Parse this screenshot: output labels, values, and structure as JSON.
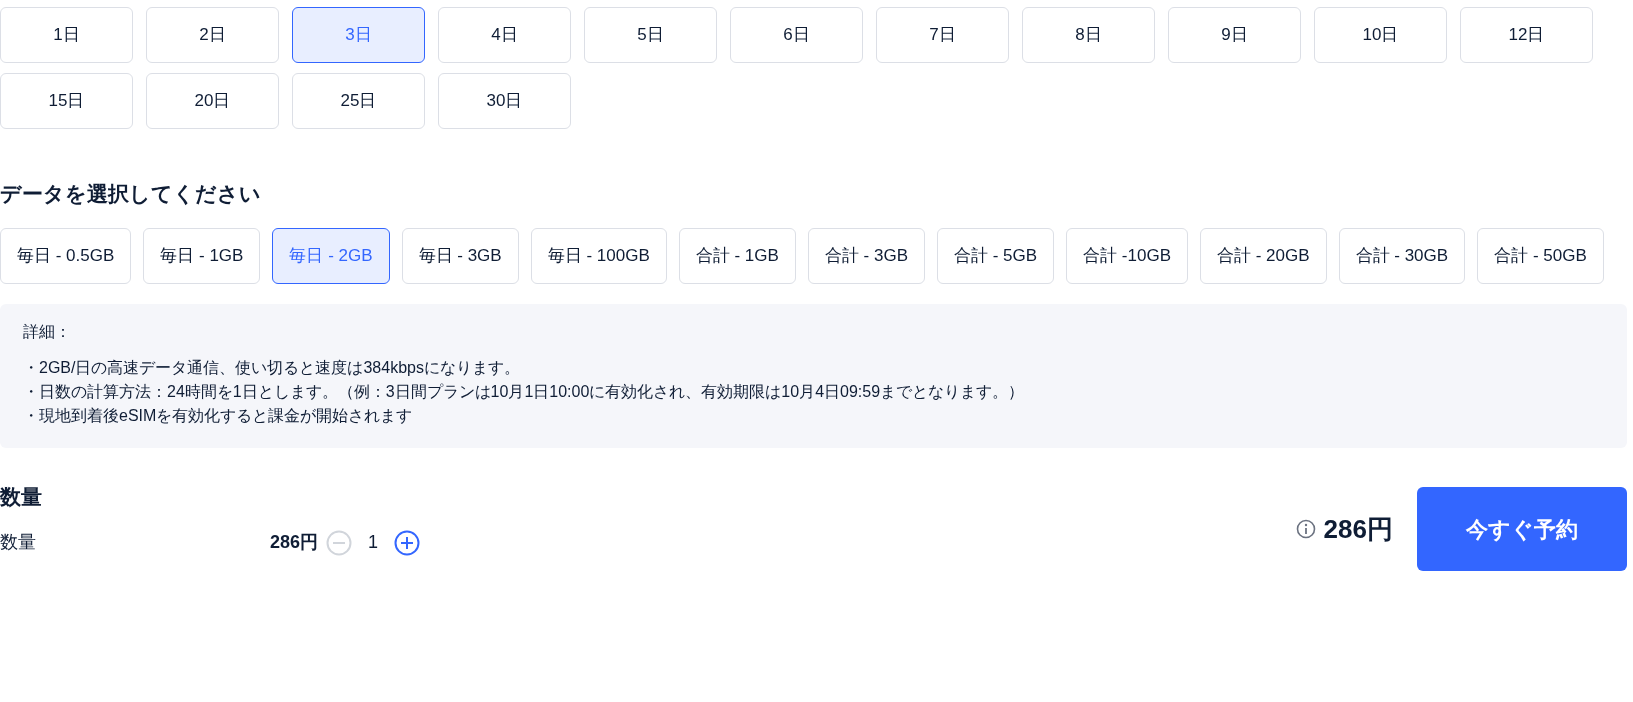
{
  "days": [
    {
      "label": "1日",
      "selected": false
    },
    {
      "label": "2日",
      "selected": false
    },
    {
      "label": "3日",
      "selected": true
    },
    {
      "label": "4日",
      "selected": false
    },
    {
      "label": "5日",
      "selected": false
    },
    {
      "label": "6日",
      "selected": false
    },
    {
      "label": "7日",
      "selected": false
    },
    {
      "label": "8日",
      "selected": false
    },
    {
      "label": "9日",
      "selected": false
    },
    {
      "label": "10日",
      "selected": false
    },
    {
      "label": "12日",
      "selected": false
    },
    {
      "label": "15日",
      "selected": false
    },
    {
      "label": "20日",
      "selected": false
    },
    {
      "label": "25日",
      "selected": false
    },
    {
      "label": "30日",
      "selected": false
    }
  ],
  "data_heading": "データを選択してください",
  "data_plans": [
    {
      "label": "毎日 - 0.5GB",
      "selected": false
    },
    {
      "label": "毎日 - 1GB",
      "selected": false
    },
    {
      "label": "毎日 - 2GB",
      "selected": true
    },
    {
      "label": "毎日 - 3GB",
      "selected": false
    },
    {
      "label": "毎日 - 100GB",
      "selected": false
    },
    {
      "label": "合計 - 1GB",
      "selected": false
    },
    {
      "label": "合計 - 3GB",
      "selected": false
    },
    {
      "label": "合計 - 5GB",
      "selected": false
    },
    {
      "label": "合計 -10GB",
      "selected": false
    },
    {
      "label": "合計 - 20GB",
      "selected": false
    },
    {
      "label": "合計 - 30GB",
      "selected": false
    },
    {
      "label": "合計 - 50GB",
      "selected": false
    }
  ],
  "details": {
    "title": "詳細：",
    "lines": [
      "・2GB/日の高速データ通信、使い切ると速度は384kbpsになります。",
      "・日数の計算方法：24時間を1日とします。（例：3日間プランは10月1日10:00に有効化され、有効期限は10月4日09:59までとなります。）",
      "・現地到着後eSIMを有効化すると課金が開始されます"
    ]
  },
  "quantity": {
    "heading": "数量",
    "label": "数量",
    "unit_price": "286円",
    "value": "1",
    "decrement_disabled": true
  },
  "total": "286円",
  "book_button": "今すぐ予約"
}
